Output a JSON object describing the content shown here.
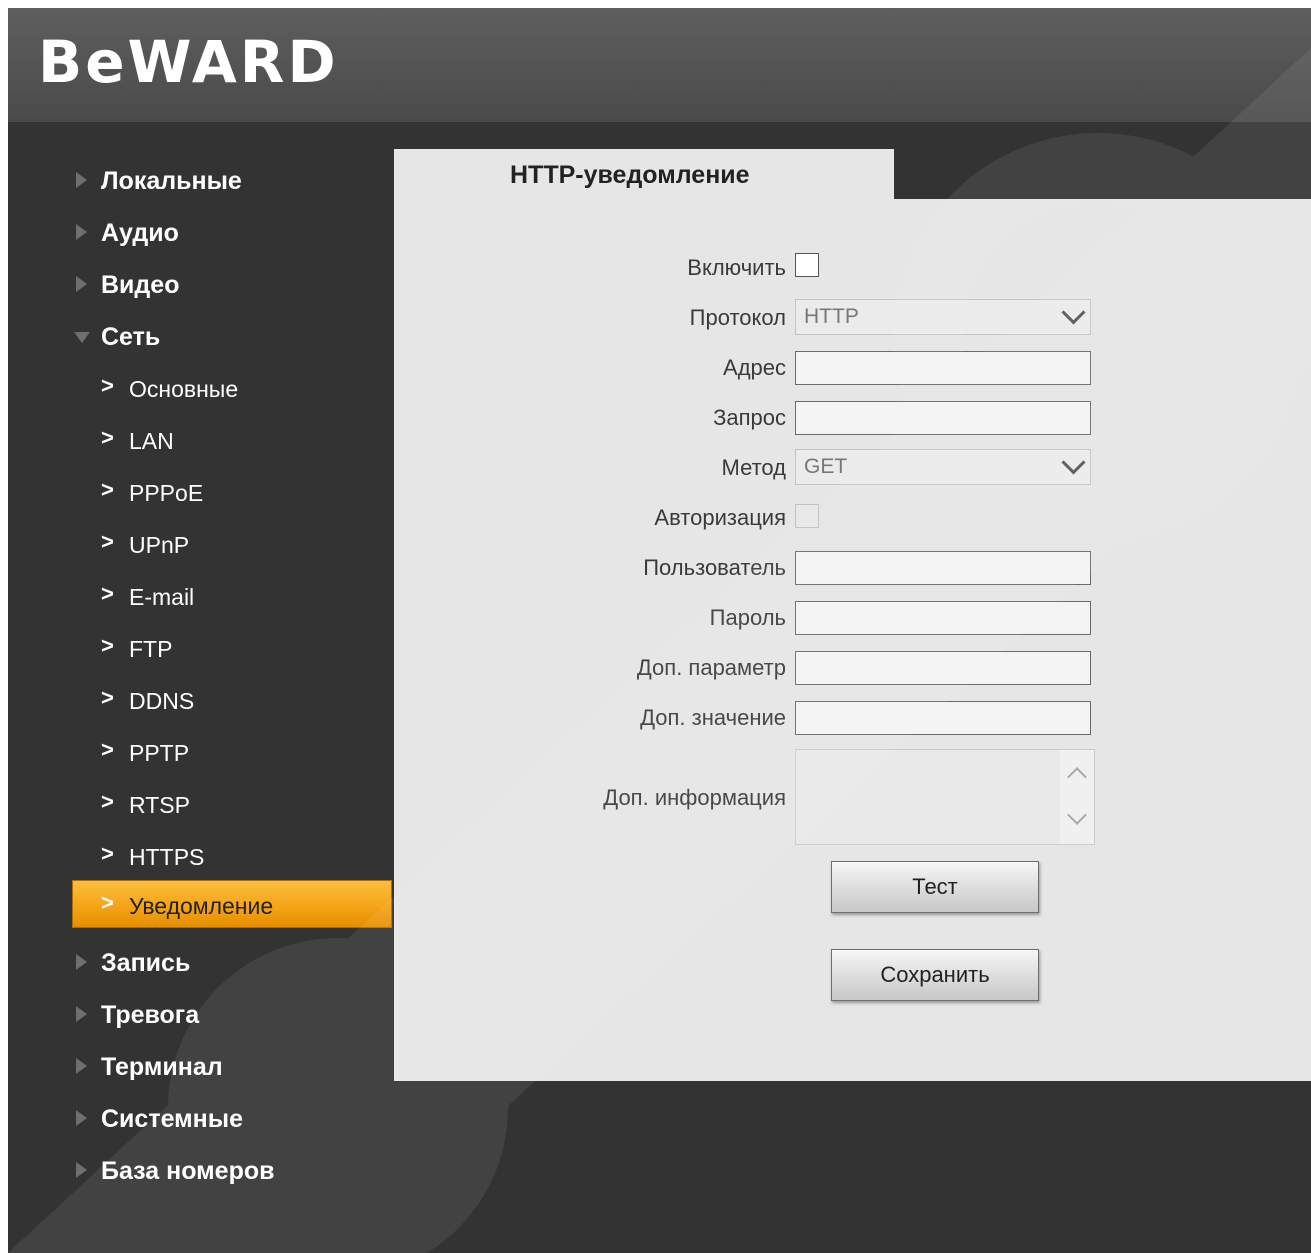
{
  "brand": {
    "logo_text": "BeWARD"
  },
  "sidebar": {
    "items": [
      {
        "label": "Локальные",
        "type": "section",
        "expanded": false
      },
      {
        "label": "Аудио",
        "type": "section",
        "expanded": false
      },
      {
        "label": "Видео",
        "type": "section",
        "expanded": false
      },
      {
        "label": "Сеть",
        "type": "section",
        "expanded": true
      },
      {
        "label": "Основные",
        "type": "sub"
      },
      {
        "label": "LAN",
        "type": "sub"
      },
      {
        "label": "PPPoE",
        "type": "sub"
      },
      {
        "label": "UPnP",
        "type": "sub"
      },
      {
        "label": "E-mail",
        "type": "sub"
      },
      {
        "label": "FTP",
        "type": "sub"
      },
      {
        "label": "DDNS",
        "type": "sub"
      },
      {
        "label": "PPTP",
        "type": "sub"
      },
      {
        "label": "RTSP",
        "type": "sub"
      },
      {
        "label": "HTTPS",
        "type": "sub"
      },
      {
        "label": "Уведомление",
        "type": "sub",
        "active": true
      },
      {
        "label": "Запись",
        "type": "section",
        "expanded": false
      },
      {
        "label": "Тревога",
        "type": "section",
        "expanded": false
      },
      {
        "label": "Терминал",
        "type": "section",
        "expanded": false
      },
      {
        "label": "Системные",
        "type": "section",
        "expanded": false
      },
      {
        "label": "База номеров",
        "type": "section",
        "expanded": false
      }
    ]
  },
  "content": {
    "tab_title": "HTTP-уведомление",
    "form": {
      "enable_label": "Включить",
      "enable_checked": false,
      "protocol_label": "Протокол",
      "protocol_value": "HTTP",
      "address_label": "Адрес",
      "address_value": "",
      "request_label": "Запрос",
      "request_value": "",
      "method_label": "Метод",
      "method_value": "GET",
      "auth_label": "Авторизация",
      "auth_checked": false,
      "user_label": "Пользователь",
      "user_value": "",
      "password_label": "Пароль",
      "password_value": "",
      "extra_param_label": "Доп. параметр",
      "extra_param_value": "",
      "extra_value_label": "Доп. значение",
      "extra_value_value": "",
      "extra_info_label": "Доп. информация",
      "extra_info_value": ""
    },
    "buttons": {
      "test_label": "Тест",
      "save_label": "Сохранить"
    }
  },
  "colors": {
    "background": "#333333",
    "header": "#555555",
    "panel": "#e6e6e6",
    "active_item": "#f5a418"
  }
}
